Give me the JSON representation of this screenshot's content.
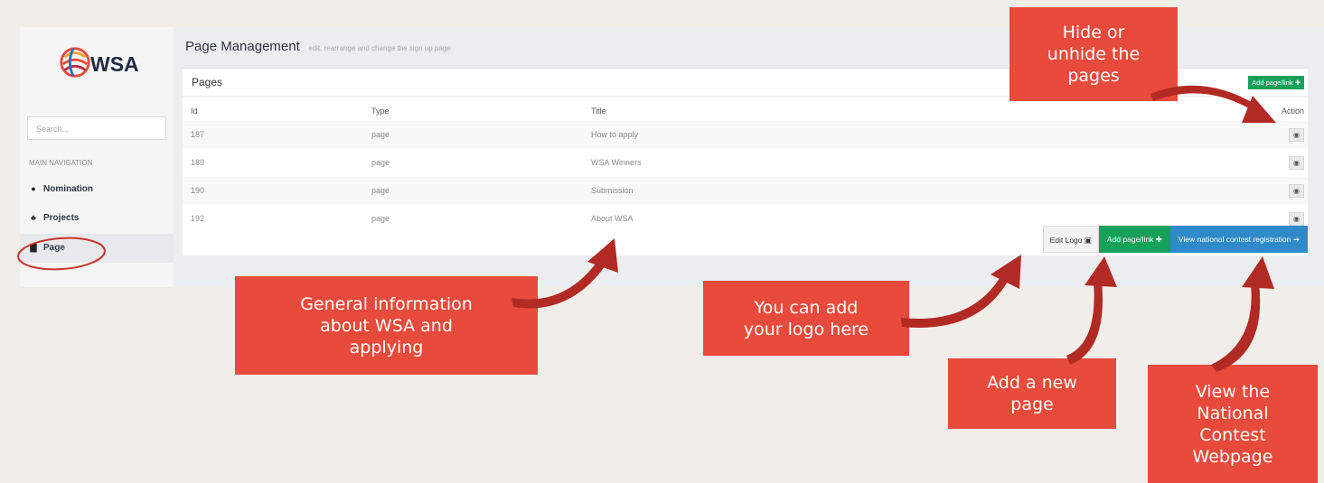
{
  "sidebar": {
    "logo_text": "WSA",
    "search_placeholder": "Search...",
    "nav_header": "MAIN NAVIGATION",
    "items": [
      {
        "label": "Nomination",
        "icon": "circle-icon"
      },
      {
        "label": "Projects",
        "icon": "sitemap-icon"
      },
      {
        "label": "Page",
        "icon": "file-icon"
      }
    ]
  },
  "header": {
    "title": "Page Management",
    "subtitle": "edit, rearrange and change the sign up page"
  },
  "panel": {
    "title": "Pages",
    "add_top_label": "Add page/link ✚",
    "columns": [
      "Id",
      "Type",
      "Title",
      "Action"
    ],
    "rows": [
      {
        "id": "187",
        "type": "page",
        "title": "How to apply"
      },
      {
        "id": "189",
        "type": "page",
        "title": "WSA Winners"
      },
      {
        "id": "190",
        "type": "page",
        "title": "Submission"
      },
      {
        "id": "192",
        "type": "page",
        "title": "About WSA"
      }
    ],
    "footer": {
      "edit_logo_label": "Edit Logo",
      "add_label": "Add page/link ✚",
      "view_label": "View national contest registration ➔"
    }
  },
  "callouts": {
    "hide_lines": [
      "Hide or",
      "unhide the",
      "pages"
    ],
    "general_lines": [
      "General information",
      "about WSA and",
      "applying"
    ],
    "logo_lines": [
      "You can add",
      "your logo here"
    ],
    "addnew_lines": [
      "Add a new",
      "page"
    ],
    "view_lines": [
      "View the",
      "National",
      "Contest",
      "Webpage"
    ]
  },
  "colors": {
    "accent_red": "#e84a3b",
    "arrow_red": "#b12b24",
    "green": "#17a05a",
    "blue": "#2e8ac9"
  }
}
